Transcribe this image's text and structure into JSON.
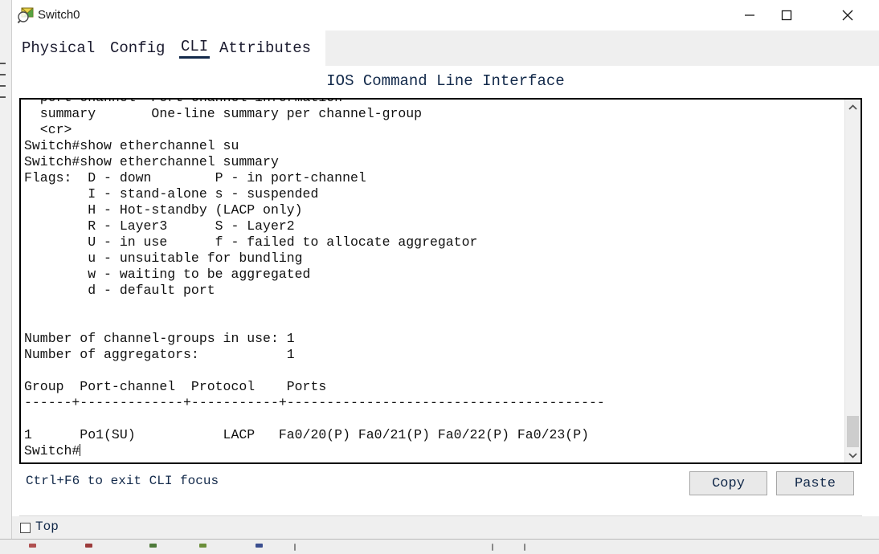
{
  "window": {
    "title": "Switch0",
    "icon": "packet-tracer-device-icon",
    "controls": {
      "minimize": "minimize-icon",
      "maximize": "maximize-icon",
      "close": "close-icon"
    }
  },
  "tabs": [
    {
      "label": "Physical",
      "selected": false
    },
    {
      "label": "Config",
      "selected": false
    },
    {
      "label": "CLI",
      "selected": true
    },
    {
      "label": "Attributes",
      "selected": false
    }
  ],
  "panel": {
    "title": "IOS Command Line Interface"
  },
  "terminal": {
    "content": "  port-channel  Port channel information\n  summary       One-line summary per channel-group\n  <cr>\nSwitch#show etherchannel su\nSwitch#show etherchannel summary\nFlags:  D - down        P - in port-channel\n        I - stand-alone s - suspended\n        H - Hot-standby (LACP only)\n        R - Layer3      S - Layer2\n        U - in use      f - failed to allocate aggregator\n        u - unsuitable for bundling\n        w - waiting to be aggregated\n        d - default port\n\n\nNumber of channel-groups in use: 1\nNumber of aggregators:           1\n\nGroup  Port-channel  Protocol    Ports\n------+-------------+-----------+----------------------------------------\n\n1      Po1(SU)           LACP   Fa0/20(P) Fa0/21(P) Fa0/22(P) Fa0/23(P)\n",
    "prompt": "Switch#",
    "scrollbar": {
      "up_arrow": "chevron-up-icon",
      "down_arrow": "chevron-down-icon"
    }
  },
  "footer": {
    "hint": "Ctrl+F6 to exit CLI focus",
    "copy_label": "Copy",
    "paste_label": "Paste"
  },
  "bottom": {
    "top_label": "Top",
    "top_checked": false
  },
  "colors": {
    "accent": "#12294a",
    "terminal_text": "#111111",
    "tab_strip": "#efefef",
    "button_face": "#e9e9e9",
    "scroll_thumb": "#cdcdcd"
  }
}
